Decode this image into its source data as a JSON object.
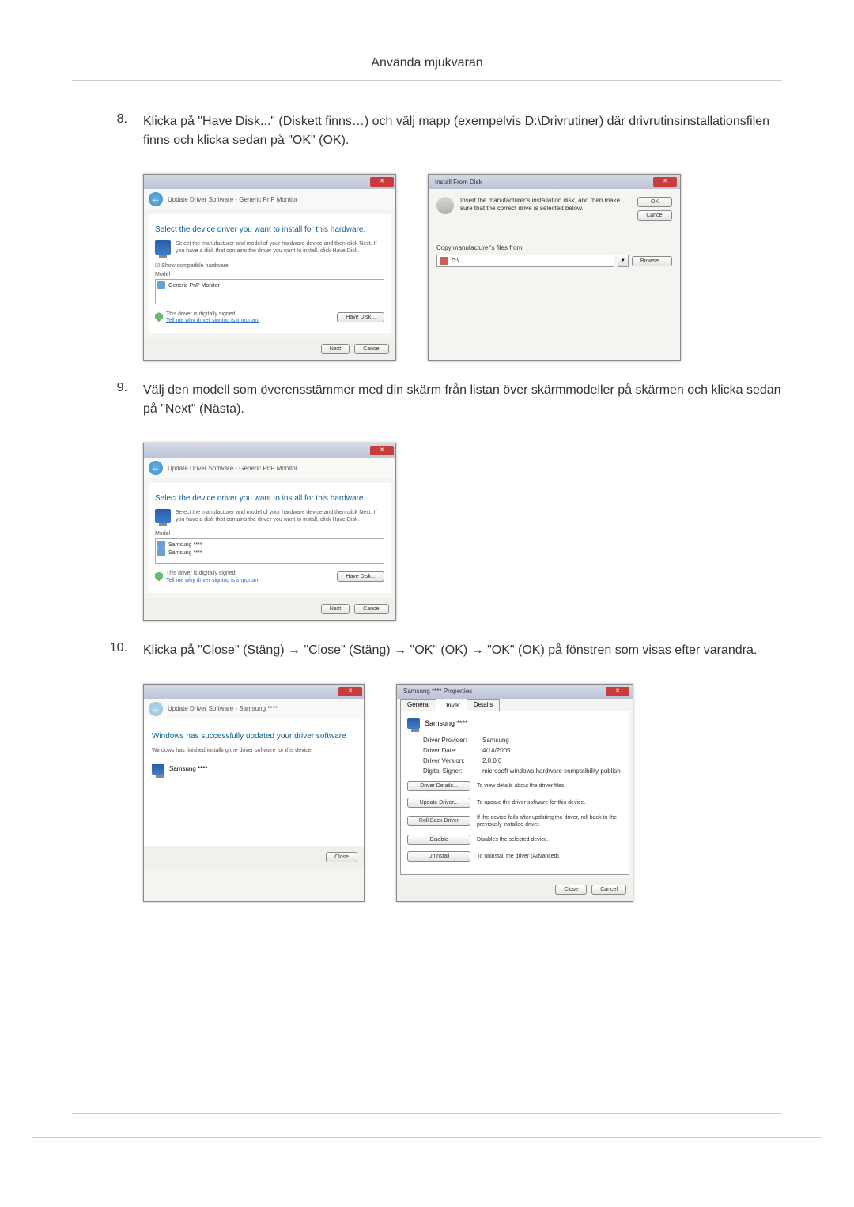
{
  "header": "Använda mjukvaran",
  "steps": {
    "s8": {
      "num": "8.",
      "text": "Klicka på \"Have Disk...\" (Diskett finns…) och välj mapp (exempelvis D:\\Drivrutiner) där drivrutinsinstallationsfilen finns och klicka sedan på \"OK\" (OK)."
    },
    "s9": {
      "num": "9.",
      "text": "Välj den modell som överensstämmer med din skärm från listan över skärmmodeller på skärmen och klicka sedan på \"Next\" (Nästa)."
    },
    "s10": {
      "num": "10.",
      "text": "Klicka på \"Close\" (Stäng) → \"Close\" (Stäng) → \"OK\" (OK) → \"OK\" (OK) på fönstren som visas efter varandra."
    }
  },
  "dialog1": {
    "navTitle": "Update Driver Software - Generic PnP Monitor",
    "heading": "Select the device driver you want to install for this hardware.",
    "instruction": "Select the manufacturer and model of your hardware device and then click Next. If you have a disk that contains the driver you want to install, click Have Disk.",
    "checkbox": "☑ Show compatible hardware",
    "modelLabel": "Model",
    "modelItem": "Generic PnP Monitor",
    "signedText": "This driver is digitally signed.",
    "signedLink": "Tell me why driver signing is important",
    "haveDisk": "Have Disk...",
    "next": "Next",
    "cancel": "Cancel"
  },
  "installDisk": {
    "title": "Install From Disk",
    "text": "Insert the manufacturer's installation disk, and then make sure that the correct drive is selected below.",
    "ok": "OK",
    "cancel": "Cancel",
    "copyLabel": "Copy manufacturer's files from:",
    "path": "D:\\",
    "browse": "Browse..."
  },
  "dialog2": {
    "navTitle": "Update Driver Software - Generic PnP Monitor",
    "heading": "Select the device driver you want to install for this hardware.",
    "instruction": "Select the manufacturer and model of your hardware device and then click Next. If you have a disk that contains the driver you want to install, click Have Disk.",
    "modelLabel": "Model",
    "model1": "Samsung ****",
    "model2": "Samsung ****",
    "signedText": "This driver is digitally signed.",
    "signedLink": "Tell me why driver signing is important",
    "haveDisk": "Have Disk...",
    "next": "Next",
    "cancel": "Cancel"
  },
  "successDlg": {
    "navTitle": "Update Driver Software - Samsung ****",
    "heading": "Windows has successfully updated your driver software",
    "sub": "Windows has finished installing the driver software for this device:",
    "device": "Samsung ****",
    "close": "Close"
  },
  "props": {
    "title": "Samsung **** Properties",
    "tabGeneral": "General",
    "tabDriver": "Driver",
    "tabDetails": "Details",
    "deviceName": "Samsung ****",
    "providerLabel": "Driver Provider:",
    "providerVal": "Samsung",
    "dateLabel": "Driver Date:",
    "dateVal": "4/14/2005",
    "versionLabel": "Driver Version:",
    "versionVal": "2.0.0.0",
    "signerLabel": "Digital Signer:",
    "signerVal": "microsoft windows hardware compatibility publish",
    "detailsBtn": "Driver Details...",
    "detailsDesc": "To view details about the driver files.",
    "updateBtn": "Update Driver...",
    "updateDesc": "To update the driver software for this device.",
    "rollBtn": "Roll Back Driver",
    "rollDesc": "If the device fails after updating the driver, roll back to the previously installed driver.",
    "disableBtn": "Disable",
    "disableDesc": "Disables the selected device.",
    "uninstallBtn": "Uninstall",
    "uninstallDesc": "To uninstall the driver (Advanced).",
    "close": "Close",
    "cancel": "Cancel"
  }
}
